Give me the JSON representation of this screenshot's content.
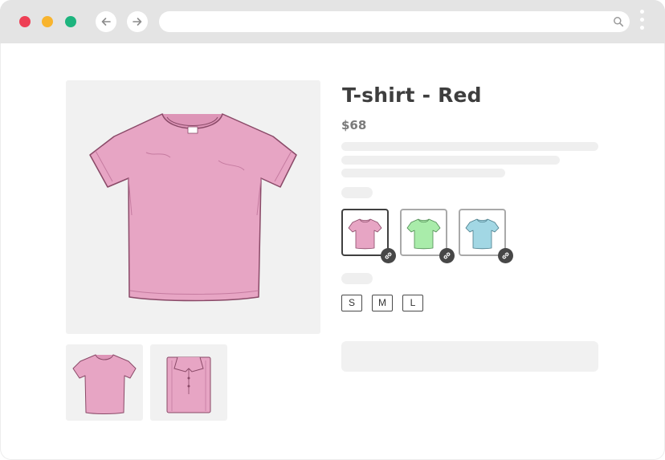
{
  "window": {
    "traffic_light_colors": [
      "#ee3f55",
      "#f8b42e",
      "#1db47e"
    ]
  },
  "toolbar": {
    "back_icon": "arrow-left-icon",
    "forward_icon": "arrow-right-icon",
    "url": "",
    "search_icon": "search-icon",
    "menu_icon": "kebab-menu-icon"
  },
  "product": {
    "title": "T-shirt - Red",
    "price": "$68",
    "colors": [
      {
        "name": "pink",
        "hex": "#e7a5c4",
        "selected": true,
        "icon": "link-icon"
      },
      {
        "name": "green",
        "hex": "#a9ecaa",
        "selected": false,
        "icon": "link-icon"
      },
      {
        "name": "blue",
        "hex": "#a2d7e4",
        "selected": false,
        "icon": "link-icon"
      }
    ],
    "sizes": [
      "S",
      "M",
      "L"
    ]
  },
  "gallery": {
    "main_image": "pink-tshirt-front",
    "thumbnails": [
      "pink-tshirt-front",
      "pink-polo-folded"
    ]
  }
}
